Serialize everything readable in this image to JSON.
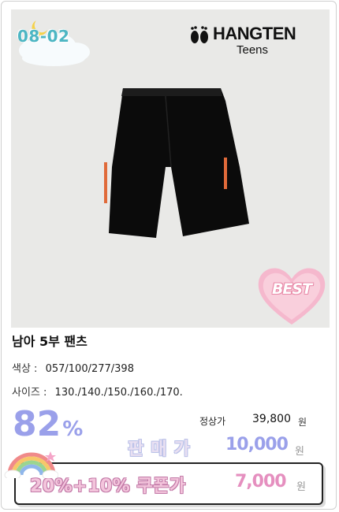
{
  "photo": {
    "code": "08-02",
    "brand_name": "HANGTEN",
    "brand_sub": "Teens",
    "best_badge": "BEST"
  },
  "product": {
    "title": "남아 5부 팬츠",
    "color_label": "색상 :",
    "color_value": "057/100/277/398",
    "size_label": "사이즈 :",
    "size_value": "130./140./150./160./170."
  },
  "pricing": {
    "discount": "82",
    "discount_unit": "%",
    "original_label": "정상가",
    "original_price": "39,800",
    "original_unit": "원",
    "sale_label": "판매가",
    "sale_price": "10,000",
    "sale_unit": "원",
    "coupon_label": "20%+10% 쿠폰가",
    "coupon_price": "7,000",
    "coupon_unit": "원"
  },
  "colors": {
    "accent_purple": "#9aa0ea",
    "accent_pink": "#e58fbf",
    "code_teal": "#4db6c3"
  }
}
